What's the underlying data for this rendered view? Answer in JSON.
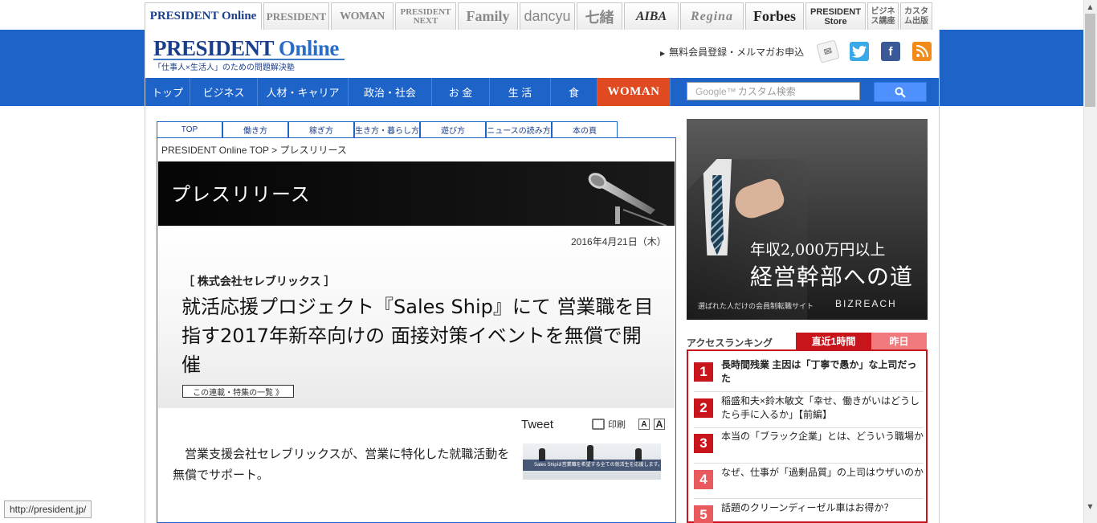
{
  "site_tabs": [
    {
      "label": "PRESIDENT Online",
      "active": true
    },
    {
      "label": "PRESIDENT"
    },
    {
      "label": "WOMAN"
    },
    {
      "label": "PRESIDENT NEXT"
    },
    {
      "label": "Family"
    },
    {
      "label": "dancyu"
    },
    {
      "label": "七緒"
    },
    {
      "label": "AIBA"
    },
    {
      "label": "Regina"
    },
    {
      "label": "Forbes"
    },
    {
      "label": "PRESIDENT Store"
    },
    {
      "label": "ビジネス講座"
    },
    {
      "label": "カスタム出版"
    }
  ],
  "header": {
    "logo_president": "PRESIDENT",
    "logo_online": "Online",
    "tagline": "「仕事人×生活人」のための問題解決塾",
    "register_link": "無料会員登録・メルマガお申込",
    "social": [
      "mail",
      "twitter",
      "facebook",
      "rss"
    ]
  },
  "nav": {
    "items": [
      "トップ",
      "ビジネス",
      "人材・キャリア",
      "政治・社会",
      "お 金",
      "生 活",
      "食",
      "WOMAN"
    ],
    "search_placeholder": "カスタム検索",
    "search_brand": "Google™"
  },
  "sub_tabs": [
    "TOP",
    "働き方",
    "稼ぎ方",
    "生き方・暮らし方",
    "遊び方",
    "ニュースの読み方",
    "本の頁"
  ],
  "breadcrumb": "PRESIDENT Online TOP > プレスリリース",
  "banner_title": "プレスリリース",
  "article": {
    "date": "2016年4月21日（木）",
    "company": "［ 株式会社セレブリックス ］",
    "headline": "就活応援プロジェクト『Sales Ship』にて 営業職を目指す2017年新卒向けの 面接対策イベントを無償で開催",
    "series_link": "この連載・特集の一覧 》",
    "tweet": "Tweet",
    "print": "印刷",
    "font_small": "A",
    "font_large": "A",
    "body": "営業支援会社セレブリックスが、営業に特化した就職活動を無償でサポート。",
    "thumb_caption": "Sales Shipは営業職を希望する全ての就活生を応援します。"
  },
  "ad": {
    "line1": "年収2,000万円以上",
    "line2": "経営幹部への道",
    "small": "選ばれた人だけの会員制転職サイト",
    "brand": "BIZREACH"
  },
  "ranking": {
    "title": "アクセスランキング",
    "tab_active": "直近1時間",
    "tab_other": "昨日",
    "items": [
      {
        "rank": "1",
        "text": "長時間残業 主因は「丁寧で愚か」な上司だった"
      },
      {
        "rank": "2",
        "text": "稲盛和夫×鈴木敏文「幸せ、働きがいはどうしたら手に入るか」【前編】"
      },
      {
        "rank": "3",
        "text": "本当の「ブラック企業」とは、どういう職場か"
      },
      {
        "rank": "4",
        "text": "なぜ、仕事が「過剰品質」の上司はウザいのか"
      },
      {
        "rank": "5",
        "text": "話題のクリーンディーゼル車はお得か？"
      }
    ]
  },
  "status_bar": "http://president.jp/",
  "colors": {
    "nav_blue": "#1e63c8",
    "woman_orange": "#e04a20",
    "ranking_red": "#c8151b"
  }
}
